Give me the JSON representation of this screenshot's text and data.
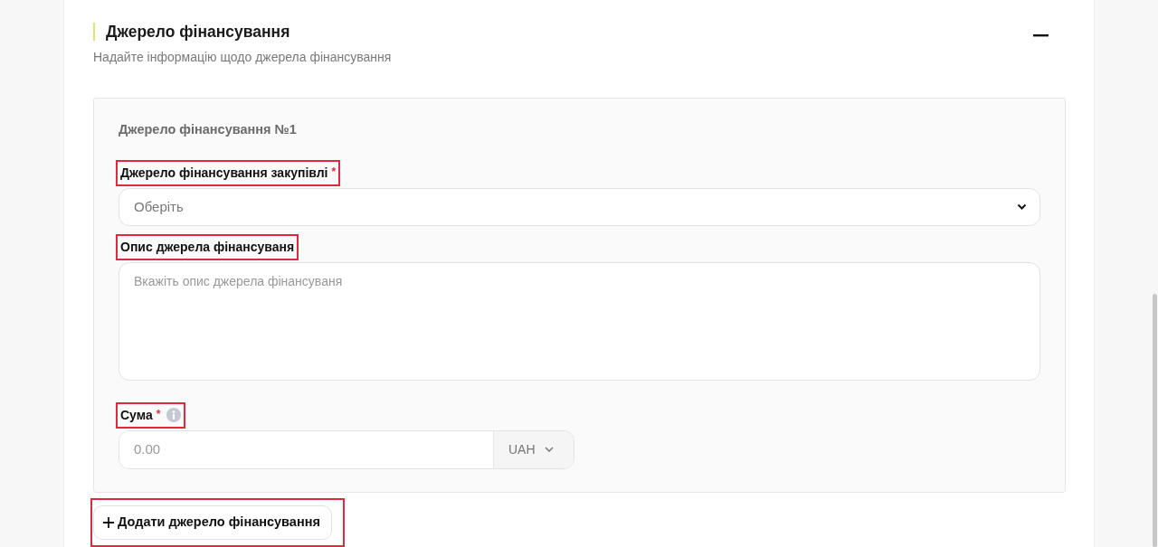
{
  "section": {
    "title": "Джерело фінансування",
    "subtitle": "Надайте інформацію щодо джерела фінансування",
    "expanded": true
  },
  "sources": [
    {
      "heading": "Джерело фінансування №1",
      "fields": [
        {
          "kind": "select",
          "label": "Джерело фінансування закупівлі",
          "required_mark": "*",
          "info": false,
          "highlighted": true,
          "placeholder": "Оберіть"
        },
        {
          "kind": "textarea",
          "label": "Опис джерела фінансуваня",
          "info": false,
          "highlighted": true,
          "placeholder": "Вкажіть опис джерела фінансуваня"
        },
        {
          "kind": "amount",
          "label": "Сума",
          "required_mark": "*",
          "info": true,
          "highlighted": true,
          "placeholder": "0.00",
          "currency": "UAH"
        }
      ]
    }
  ],
  "add_button": {
    "label": "Додати джерело фінансування",
    "highlighted": true
  }
}
